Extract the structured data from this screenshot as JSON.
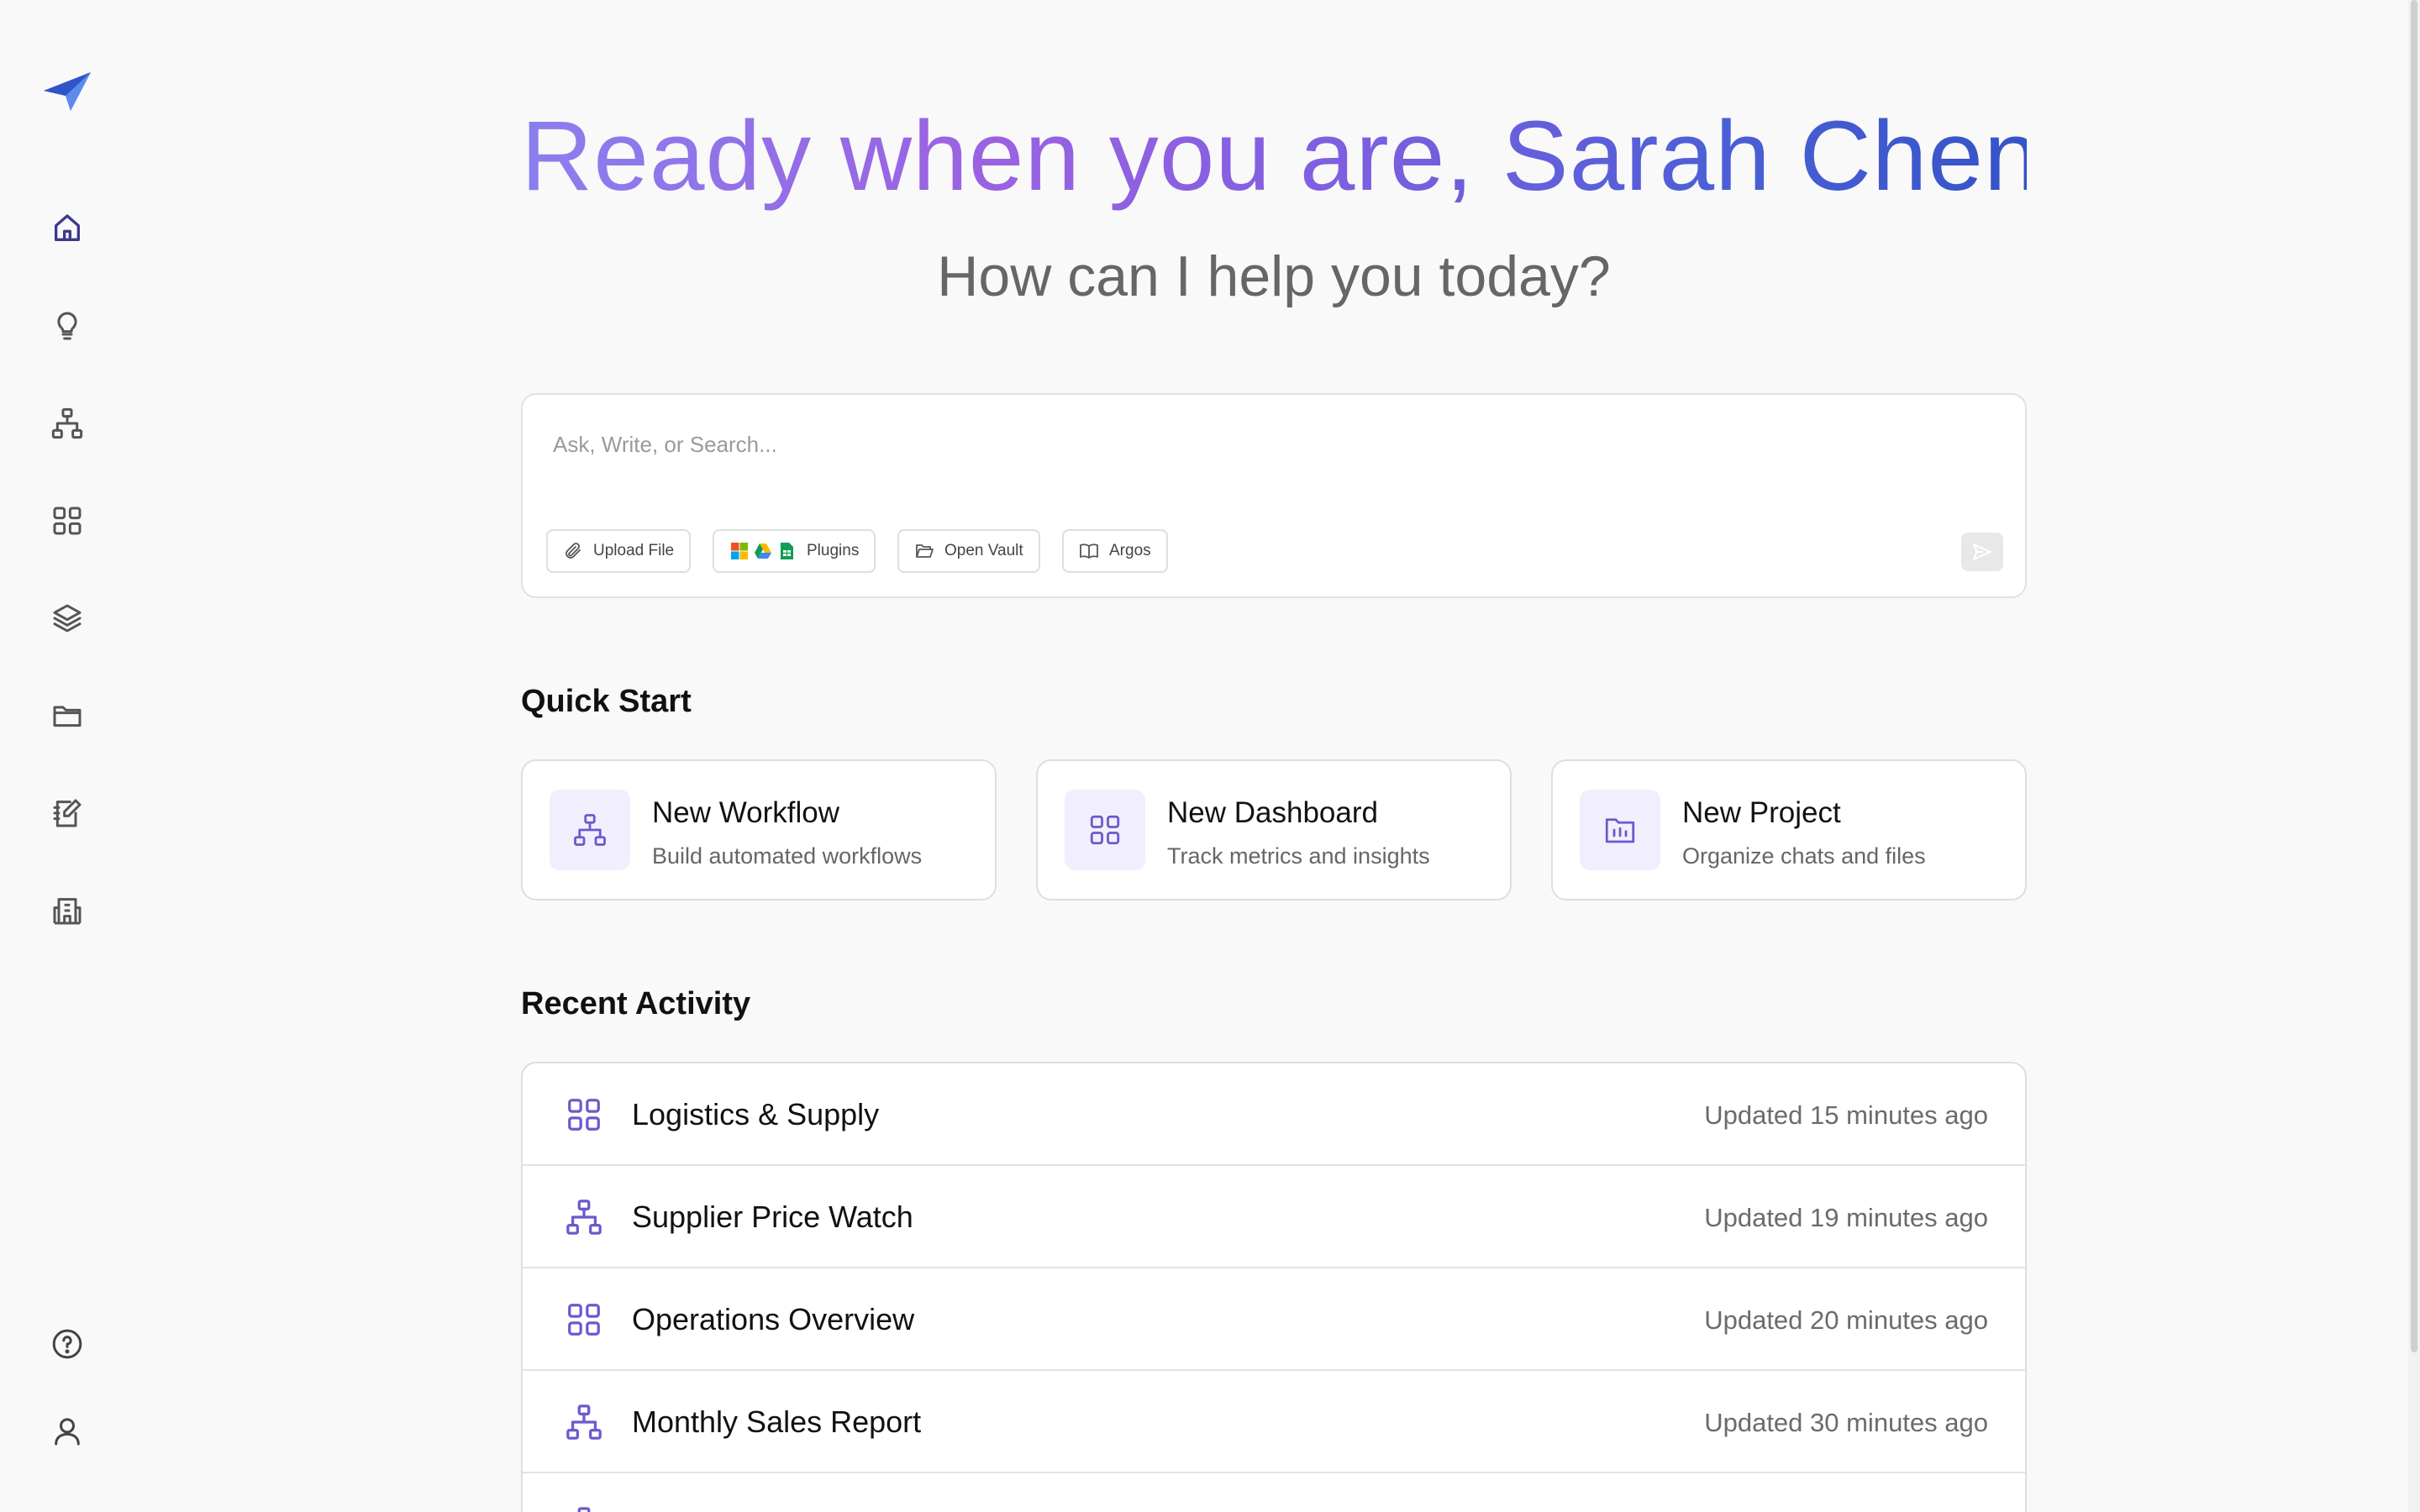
{
  "greeting": "Ready when you are, Sarah Chen",
  "subtitle": "How can I help you today?",
  "composer": {
    "placeholder": "Ask, Write, or Search...",
    "chips": {
      "upload": "Upload File",
      "plugins": "Plugins",
      "vault": "Open Vault",
      "argos": "Argos"
    }
  },
  "quick_start": {
    "title": "Quick Start",
    "cards": [
      {
        "title": "New Workflow",
        "desc": "Build automated workflows",
        "icon": "workflow-icon"
      },
      {
        "title": "New Dashboard",
        "desc": "Track metrics and insights",
        "icon": "dashboard-icon"
      },
      {
        "title": "New Project",
        "desc": "Organize chats and files",
        "icon": "project-folder-icon"
      }
    ]
  },
  "recent": {
    "title": "Recent Activity",
    "items": [
      {
        "name": "Logistics & Supply",
        "time": "Updated 15 minutes ago",
        "icon": "dashboard-icon"
      },
      {
        "name": "Supplier Price Watch",
        "time": "Updated 19 minutes ago",
        "icon": "workflow-icon"
      },
      {
        "name": "Operations Overview",
        "time": "Updated 20 minutes ago",
        "icon": "dashboard-icon"
      },
      {
        "name": "Monthly Sales Report",
        "time": "Updated 30 minutes ago",
        "icon": "workflow-icon"
      },
      {
        "name": "",
        "time": "",
        "icon": "workflow-icon"
      }
    ]
  },
  "colors": {
    "accent": "#6a5acd",
    "icon_bg": "#f1effd",
    "nav_active": "#3b3a8c",
    "nav_icon": "#555555"
  }
}
